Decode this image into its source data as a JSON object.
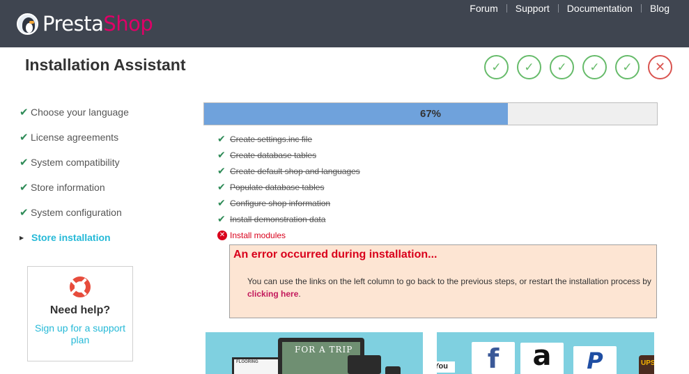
{
  "header": {
    "logo": {
      "part1": "Presta",
      "part2": "Shop"
    },
    "nav": [
      "Forum",
      "Support",
      "Documentation",
      "Blog"
    ]
  },
  "page_title": "Installation Assistant",
  "step_indicators": [
    {
      "state": "done",
      "glyph": "✓"
    },
    {
      "state": "done",
      "glyph": "✓"
    },
    {
      "state": "done",
      "glyph": "✓"
    },
    {
      "state": "done",
      "glyph": "✓"
    },
    {
      "state": "done",
      "glyph": "✓"
    },
    {
      "state": "error",
      "glyph": "✕"
    }
  ],
  "sidebar": {
    "items": [
      {
        "label": "Choose your language",
        "state": "done",
        "icon": "✔"
      },
      {
        "label": "License agreements",
        "state": "done",
        "icon": "✔"
      },
      {
        "label": "System compatibility",
        "state": "done",
        "icon": "✔"
      },
      {
        "label": "Store information",
        "state": "done",
        "icon": "✔"
      },
      {
        "label": "System configuration",
        "state": "done",
        "icon": "✔"
      },
      {
        "label": "Store installation",
        "state": "active",
        "icon": "▶"
      }
    ]
  },
  "help": {
    "title": "Need help?",
    "link": "Sign up for a support plan"
  },
  "progress": {
    "percent": 67,
    "label": "67%"
  },
  "tasks": [
    {
      "label": "Create settings.inc file",
      "state": "done",
      "icon": "✔"
    },
    {
      "label": "Create database tables",
      "state": "done",
      "icon": "✔"
    },
    {
      "label": "Create default shop and languages",
      "state": "done",
      "icon": "✔"
    },
    {
      "label": "Populate database tables",
      "state": "done",
      "icon": "✔"
    },
    {
      "label": "Configure shop information",
      "state": "done",
      "icon": "✔"
    },
    {
      "label": "Install demonstration data",
      "state": "done",
      "icon": "✔"
    },
    {
      "label": "Install modules",
      "state": "failed",
      "icon": "✕"
    }
  ],
  "error": {
    "title": "An error occurred during installation...",
    "message": "You can use the links on the left column to go back to the previous steps, or restart the installation process by ",
    "link": "clicking here",
    "suffix": "."
  },
  "banners": {
    "left": {
      "screen_text": "FOR A TRIP",
      "tablet_text": "FLOORING"
    },
    "right": {
      "brands": [
        "You",
        "f",
        "a",
        "P",
        "UPS"
      ]
    }
  },
  "colors": {
    "header_bg": "#3f4550",
    "brand_pink": "#df0067",
    "accent_blue": "#25b9d7",
    "success_green": "#66bb6a",
    "error_red": "#d9001b",
    "progress_fill": "#6fa2dc",
    "error_box_bg": "#fde5d3",
    "banner_bg": "#7fd0e0"
  }
}
